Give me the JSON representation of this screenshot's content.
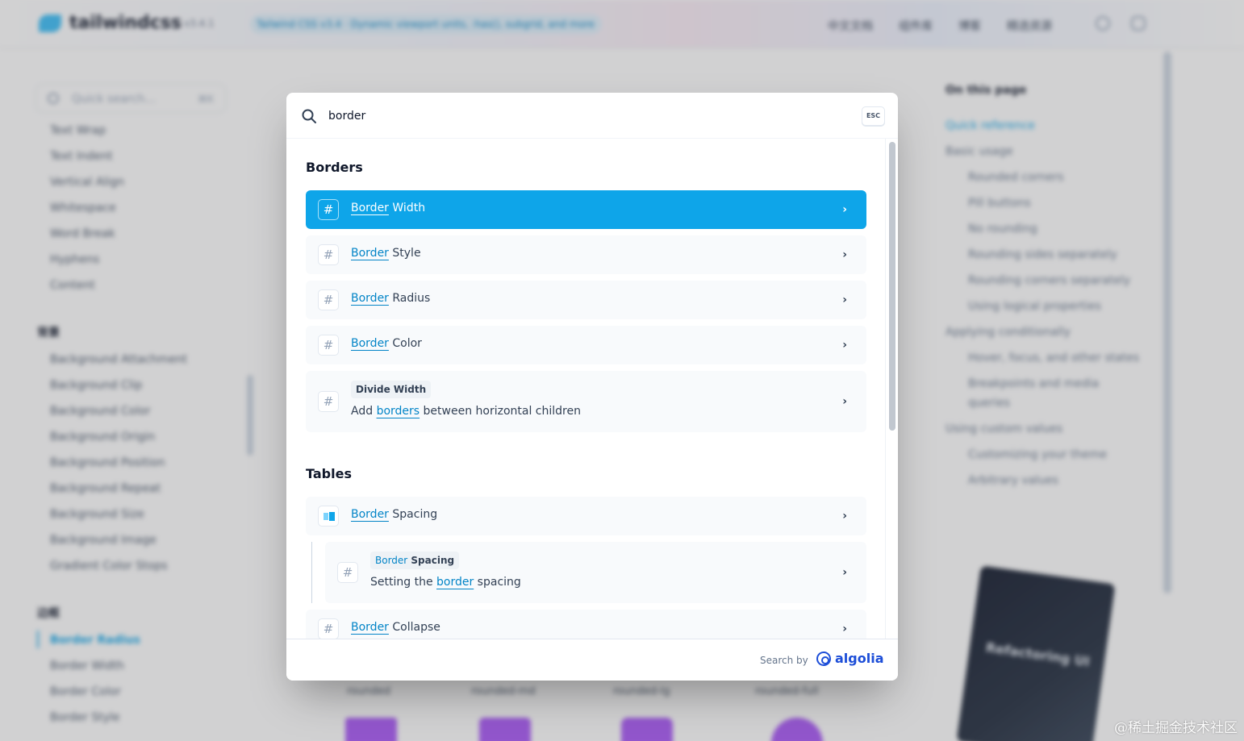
{
  "background": {
    "logo_text": "tailwindcss",
    "version": "v3.4.1",
    "banner": "Tailwind CSS v3.4 · Dynamic viewport units, :has(), subgrid, and more",
    "nav": [
      "中文文档",
      "组件库",
      "博客",
      "精选资源"
    ],
    "sidebar": {
      "search_placeholder": "Quick search...",
      "search_shortcut": "⌘K",
      "top_items": [
        "Text Wrap",
        "Text Indent",
        "Vertical Align",
        "Whitespace",
        "Word Break",
        "Hyphens",
        "Content"
      ],
      "group_backgrounds": "背景",
      "background_items": [
        "Background Attachment",
        "Background Clip",
        "Background Color",
        "Background Origin",
        "Background Position",
        "Background Repeat",
        "Background Size",
        "Background Image",
        "Gradient Color Stops"
      ],
      "group_borders": "边框",
      "border_items": [
        "Border Radius",
        "Border Width",
        "Border Color",
        "Border Style"
      ]
    },
    "main": {
      "preview_labels": [
        "rounded",
        "rounded-md",
        "rounded-lg",
        "rounded-full"
      ]
    },
    "toc": {
      "title": "On this page",
      "items": [
        "Quick reference",
        "Basic usage",
        "Rounded corners",
        "Pill buttons",
        "No rounding",
        "Rounding sides separately",
        "Rounding corners separately",
        "Using logical properties",
        "Applying conditionally",
        "Hover, focus, and other states",
        "Breakpoints and media",
        "queries",
        "Using custom values",
        "Customizing your theme",
        "Arbitrary values"
      ]
    },
    "book_title": "Refactoring UI"
  },
  "search": {
    "query": "border",
    "esc_label": "ESC"
  },
  "sections": [
    {
      "title": "Borders",
      "hits": [
        {
          "highlight": "Border",
          "rest": " Width"
        },
        {
          "highlight": "Border",
          "rest": " Style"
        },
        {
          "highlight": "Border",
          "rest": " Radius"
        },
        {
          "highlight": "Border",
          "rest": " Color"
        },
        {
          "chip": "Divide Width",
          "desc_before": "Add ",
          "desc_highlight": "borders",
          "desc_after": " between horizontal children"
        }
      ]
    },
    {
      "title": "Tables",
      "hits": [
        {
          "highlight": "Border",
          "rest": " Spacing"
        },
        {
          "chip_highlight": "Border",
          "chip_rest": " Spacing",
          "desc_before": "Setting the ",
          "desc_highlight": "border",
          "desc_after": " spacing"
        },
        {
          "highlight": "Border",
          "rest": " Collapse"
        }
      ]
    }
  ],
  "icons": {
    "hash": "#",
    "chevron": "›"
  },
  "footer": {
    "search_by": "Search by",
    "brand": "algolia"
  },
  "colors": {
    "accent": "#0ea5e9",
    "highlight": "#0284c7",
    "algolia": "#1d4ed8"
  },
  "watermark": "@稀土掘金技术社区"
}
